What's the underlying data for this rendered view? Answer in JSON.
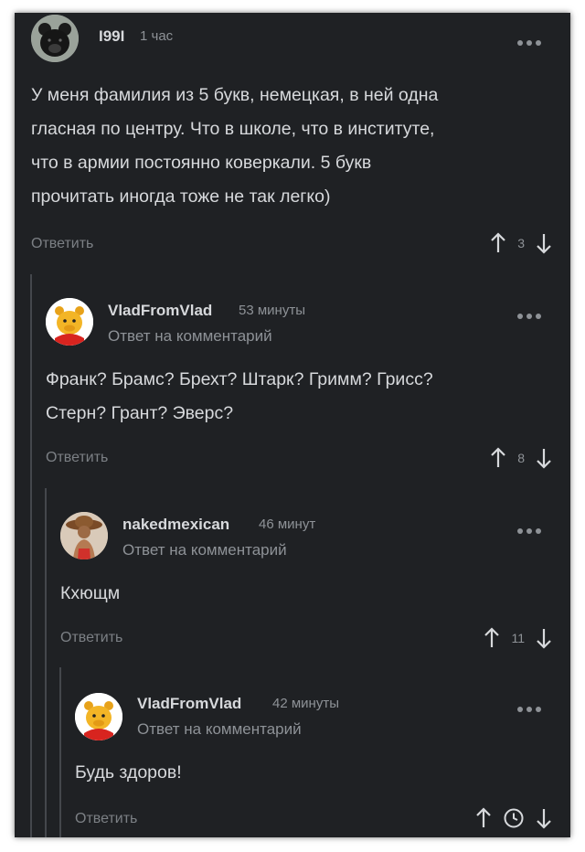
{
  "comments": [
    {
      "author": "I99I",
      "time": "1 час",
      "reply_to": "",
      "lines": [
        "У меня фамилия из 5 букв, немецкая, в ней одна",
        "гласная по центру. Что в школе, что в институте,",
        "что в армии постоянно коверкали. 5 букв",
        "прочитать иногда тоже не так легко)"
      ],
      "reply_label": "Ответить",
      "score": "3"
    },
    {
      "author": "VladFromVlad",
      "time": "53 минуты",
      "reply_to": "Ответ на комментарий",
      "lines": [
        "Франк? Брамс? Брехт? Штарк? Гримм? Грисс?",
        "Стерн? Грант? Эверс?"
      ],
      "reply_label": "Ответить",
      "score": "8"
    },
    {
      "author": "nakedmexican",
      "time": "46 минут",
      "reply_to": "Ответ на комментарий",
      "lines": [
        "Кхющм"
      ],
      "reply_label": "Ответить",
      "score": "11"
    },
    {
      "author": "VladFromVlad",
      "time": "42 минуты",
      "reply_to": "Ответ на комментарий",
      "lines": [
        "Будь здоров!"
      ],
      "reply_label": "Ответить",
      "score": ""
    }
  ],
  "icons": {
    "upvote": "arrow-up-icon",
    "downvote": "arrow-down-icon",
    "pending": "clock-icon",
    "menu": "more-dots-icon"
  },
  "colors": {
    "background": "#1f2124",
    "text": "#d7d9dc",
    "muted": "#8e9297",
    "thread_line": "#44474c"
  }
}
